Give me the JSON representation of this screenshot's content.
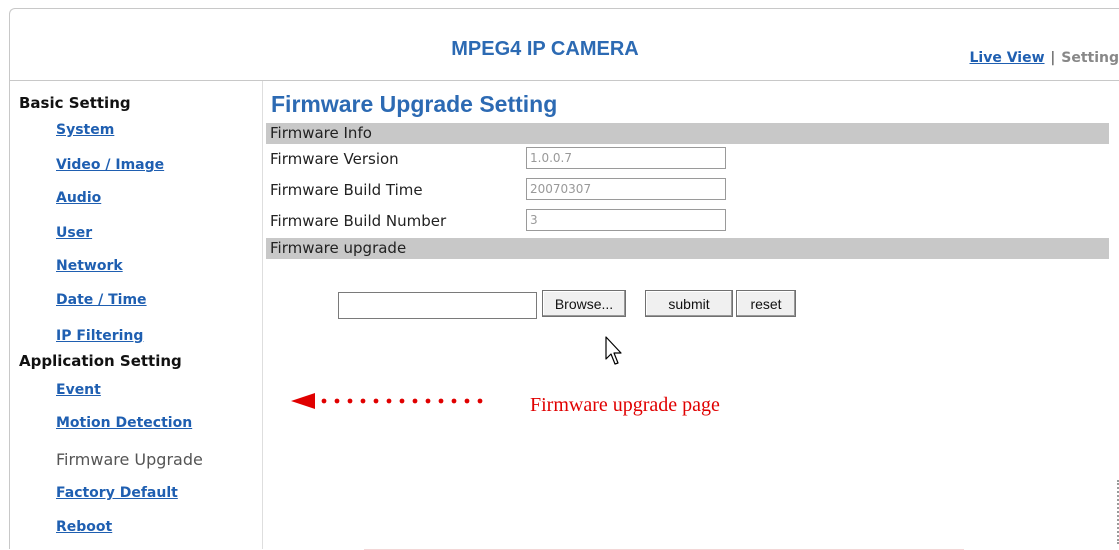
{
  "header": {
    "brand": "MPEG4 IP CAMERA",
    "live_view": "Live View",
    "separator": "|",
    "setting": "Setting"
  },
  "sidebar": {
    "basic_heading": "Basic Setting",
    "basic_items": [
      "System",
      "Video / Image",
      "Audio",
      "User",
      "Network",
      "Date / Time",
      "IP Filtering"
    ],
    "application_heading": "Application Setting",
    "application_items": [
      "Event",
      "Motion Detection",
      "Firmware Upgrade",
      "Factory Default",
      "Reboot"
    ],
    "current_item": "Firmware Upgrade"
  },
  "main": {
    "title": "Firmware Upgrade Setting",
    "info_section": "Firmware Info",
    "fields": [
      {
        "label": "Firmware Version",
        "value": "1.0.0.7"
      },
      {
        "label": "Firmware Build Time",
        "value": "20070307"
      },
      {
        "label": "Firmware Build Number",
        "value": "3"
      }
    ],
    "upgrade_section": "Firmware upgrade",
    "file_value": "",
    "browse_label": "Browse...",
    "submit_label": "submit",
    "reset_label": "reset"
  },
  "annotation": {
    "text": "Firmware upgrade page",
    "color": "#e00000"
  },
  "colors": {
    "brand": "#2c6ab3",
    "link": "#1f5fb1",
    "section_bar": "#c8c8c8"
  }
}
